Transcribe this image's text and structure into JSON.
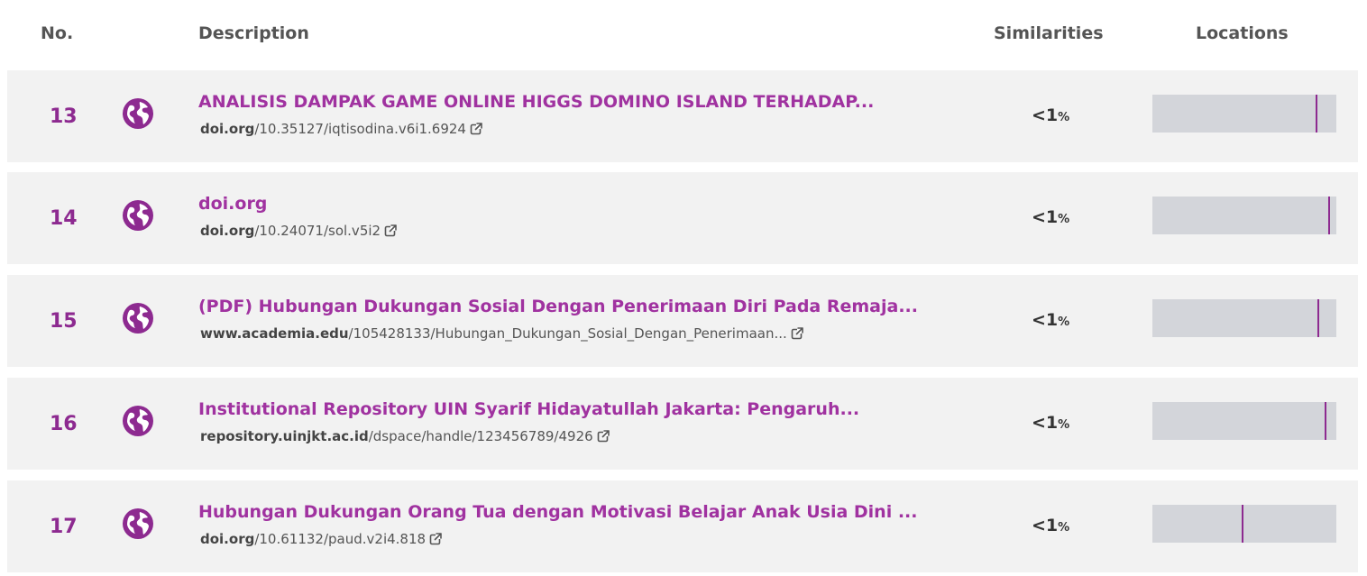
{
  "header": {
    "no": "No.",
    "description": "Description",
    "similarities": "Similarities",
    "locations": "Locations"
  },
  "rows": [
    {
      "number": "13",
      "title": "ANALISIS DAMPAK GAME ONLINE HIGGS DOMINO ISLAND TERHADAP...",
      "url_domain": "doi.org",
      "url_path": "/10.35127/iqtisodina.v6i1.6924",
      "similarity": "<1",
      "similarity_unit": "%",
      "location_marker": 0.89
    },
    {
      "number": "14",
      "title": "doi.org",
      "url_domain": "doi.org",
      "url_path": "/10.24071/sol.v5i2",
      "similarity": "<1",
      "similarity_unit": "%",
      "location_marker": 0.96
    },
    {
      "number": "15",
      "title": "(PDF) Hubungan Dukungan Sosial Dengan Penerimaan Diri Pada Remaja...",
      "url_domain": "www.academia.edu",
      "url_path": "/105428133/Hubungan_Dukungan_Sosial_Dengan_Penerimaan...",
      "similarity": "<1",
      "similarity_unit": "%",
      "location_marker": 0.9
    },
    {
      "number": "16",
      "title": "Institutional Repository UIN Syarif Hidayatullah Jakarta: Pengaruh...",
      "url_domain": "repository.uinjkt.ac.id",
      "url_path": "/dspace/handle/123456789/4926",
      "similarity": "<1",
      "similarity_unit": "%",
      "location_marker": 0.94
    },
    {
      "number": "17",
      "title": "Hubungan Dukungan Orang Tua dengan Motivasi Belajar Anak Usia Dini ...",
      "url_domain": "doi.org",
      "url_path": "/10.61132/paud.v2i4.818",
      "similarity": "<1",
      "similarity_unit": "%",
      "location_marker": 0.49
    }
  ],
  "icons": {
    "globe": "globe-icon",
    "external_link": "external-link-icon"
  },
  "colors": {
    "accent": "#a032a0",
    "number": "#8d2a90",
    "row_background": "#f2f2f2",
    "location_bar": "#d3d5da",
    "location_marker": "#8d2a90"
  }
}
